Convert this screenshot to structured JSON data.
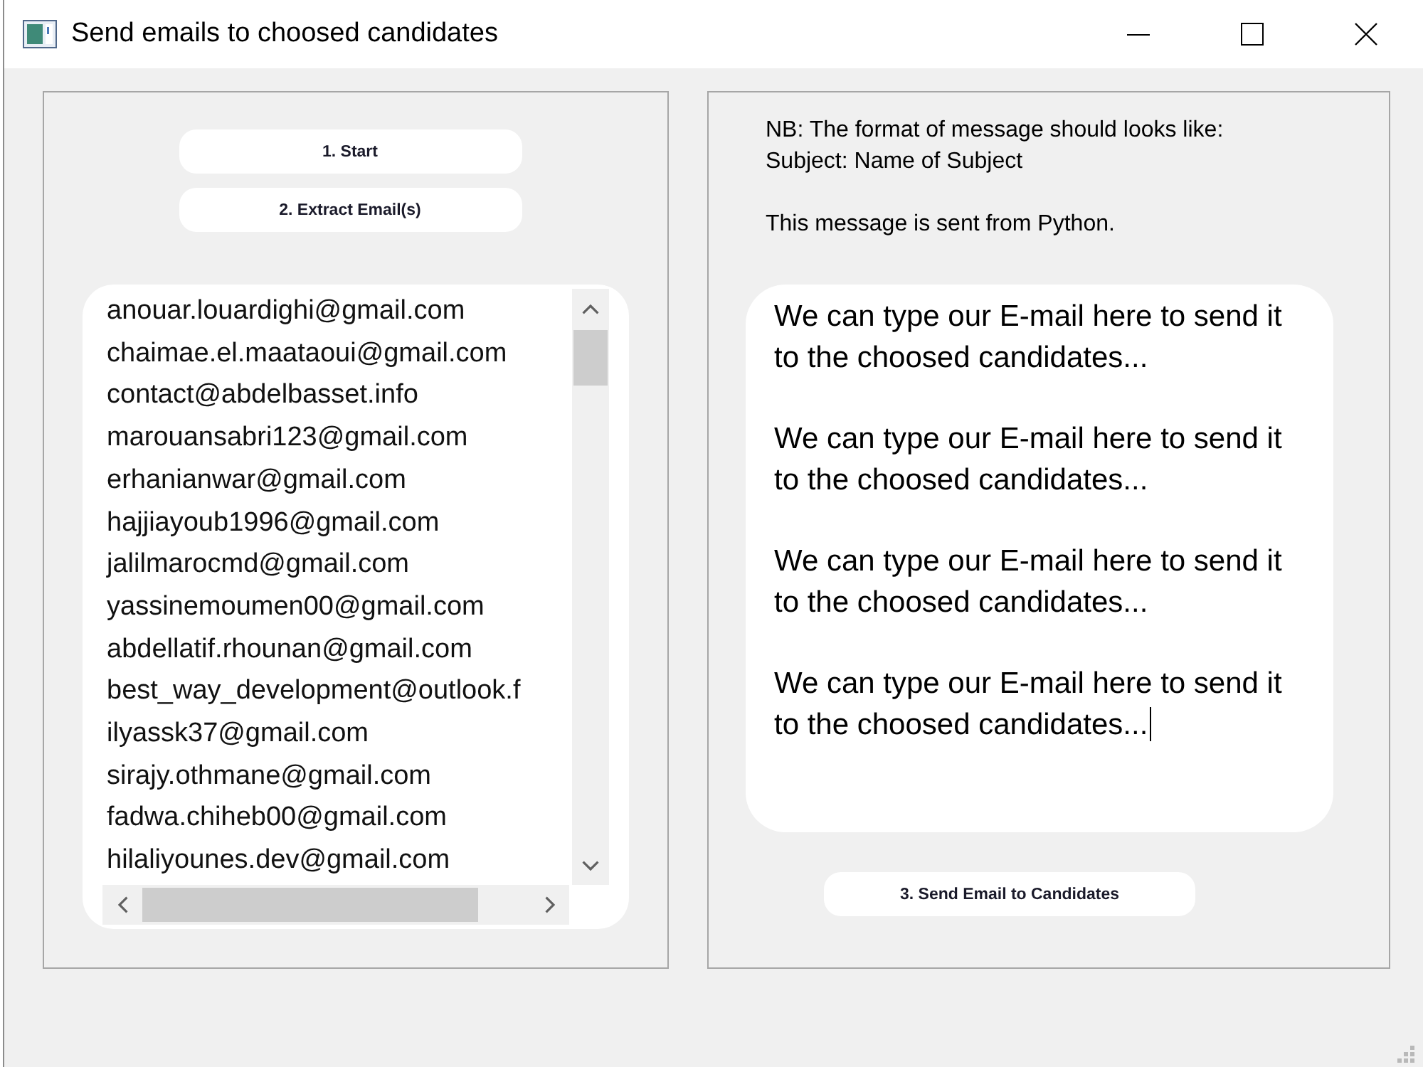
{
  "window": {
    "title": "Send emails to choosed candidates"
  },
  "left_panel": {
    "buttons": [
      {
        "label": "1. Start"
      },
      {
        "label": "2. Extract Email(s)"
      }
    ],
    "email_list": {
      "items": [
        {
          "text": "anouar.louardighi@gmail.com",
          "selected": false
        },
        {
          "text": "chaimae.el.maataoui@gmail.com",
          "selected": false
        },
        {
          "text": "contact@abdelbasset.info",
          "selected": false
        },
        {
          "text": "marouansabri123@gmail.com",
          "selected": false
        },
        {
          "text": "erhanianwar@gmail.com",
          "selected": false
        },
        {
          "text": "hajjiayoub1996@gmail.com",
          "selected": false
        },
        {
          "text": "jalilmarocmd@gmail.com",
          "selected": false
        },
        {
          "text": "yassinemoumen00@gmail.com",
          "selected": false
        },
        {
          "text": "abdellatif.rhounan@gmail.com",
          "selected": false
        },
        {
          "text": "best_way_development@outlook.f",
          "selected": false
        },
        {
          "text": "ilyassk37@gmail.com",
          "selected": false
        },
        {
          "text": "sirajy.othmane@gmail.com",
          "selected": false
        },
        {
          "text": "fadwa.chiheb00@gmail.com",
          "selected": false
        },
        {
          "text": "hilaliyounes.dev@gmail.com",
          "selected": false
        }
      ]
    }
  },
  "right_panel": {
    "note": "NB: The format of message should looks like:\nSubject: Name of Subject\n\nThis message is sent from Python.",
    "message_box": {
      "value": "We can type our E-mail here to send it to the choosed candidates...\n\nWe can type our E-mail here to send it to the choosed candidates...\n\nWe can type our E-mail here to send it to the choosed candidates...\n\nWe can type our E-mail here to send it to the choosed candidates...",
      "focused": true
    },
    "send_button": {
      "label": "3. Send Email to Candidates"
    }
  }
}
